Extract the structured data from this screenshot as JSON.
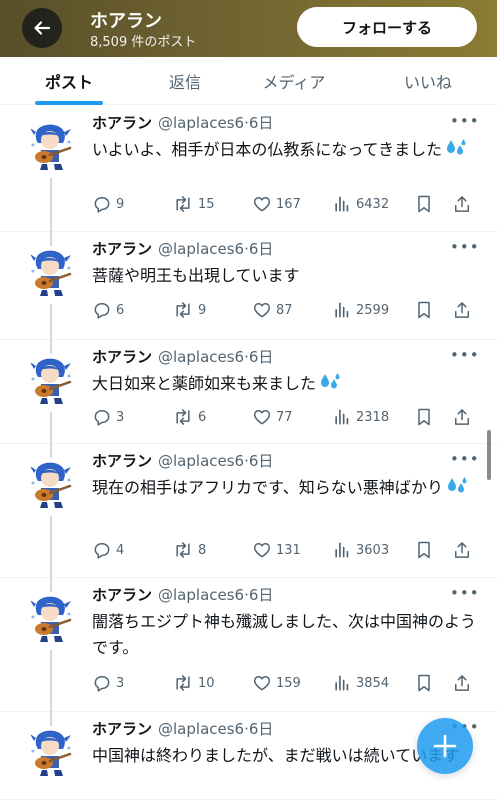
{
  "header": {
    "title": "ホアラン",
    "post_count": "8,509 件のポスト",
    "follow_label": "フォローする"
  },
  "tabs": [
    "ポスト",
    "返信",
    "メディア",
    "いいね"
  ],
  "tweets": [
    {
      "name": "ホアラン",
      "handle": "@laplaces6",
      "time": "6日",
      "text": "いよいよ、相手が日本の仏教系になってきました",
      "emoji": "sweat-droplets",
      "replies": "9",
      "reposts": "15",
      "likes": "167",
      "views": "6432"
    },
    {
      "name": "ホアラン",
      "handle": "@laplaces6",
      "time": "6日",
      "text": "菩薩や明王も出現しています",
      "emoji": "",
      "replies": "6",
      "reposts": "9",
      "likes": "87",
      "views": "2599"
    },
    {
      "name": "ホアラン",
      "handle": "@laplaces6",
      "time": "6日",
      "text": "大日如来と薬師如来も来ました",
      "emoji": "sweat-droplets",
      "replies": "3",
      "reposts": "6",
      "likes": "77",
      "views": "2318"
    },
    {
      "name": "ホアラン",
      "handle": "@laplaces6",
      "time": "6日",
      "text": "現在の相手はアフリカです、知らない悪神ばかり",
      "emoji": "sweat-droplets",
      "replies": "4",
      "reposts": "8",
      "likes": "131",
      "views": "3603"
    },
    {
      "name": "ホアラン",
      "handle": "@laplaces6",
      "time": "6日",
      "text": "闇落ちエジプト神も殲滅しました、次は中国神のようです。",
      "emoji": "",
      "replies": "3",
      "reposts": "10",
      "likes": "159",
      "views": "3854"
    },
    {
      "name": "ホアラン",
      "handle": "@laplaces6",
      "time": "6日",
      "text": "中国神は終わりましたが、まだ戦いは続いています",
      "emoji": ""
    }
  ],
  "colors": {
    "accent": "#1d9bf0",
    "muted": "#536471",
    "text": "#0f1419"
  }
}
